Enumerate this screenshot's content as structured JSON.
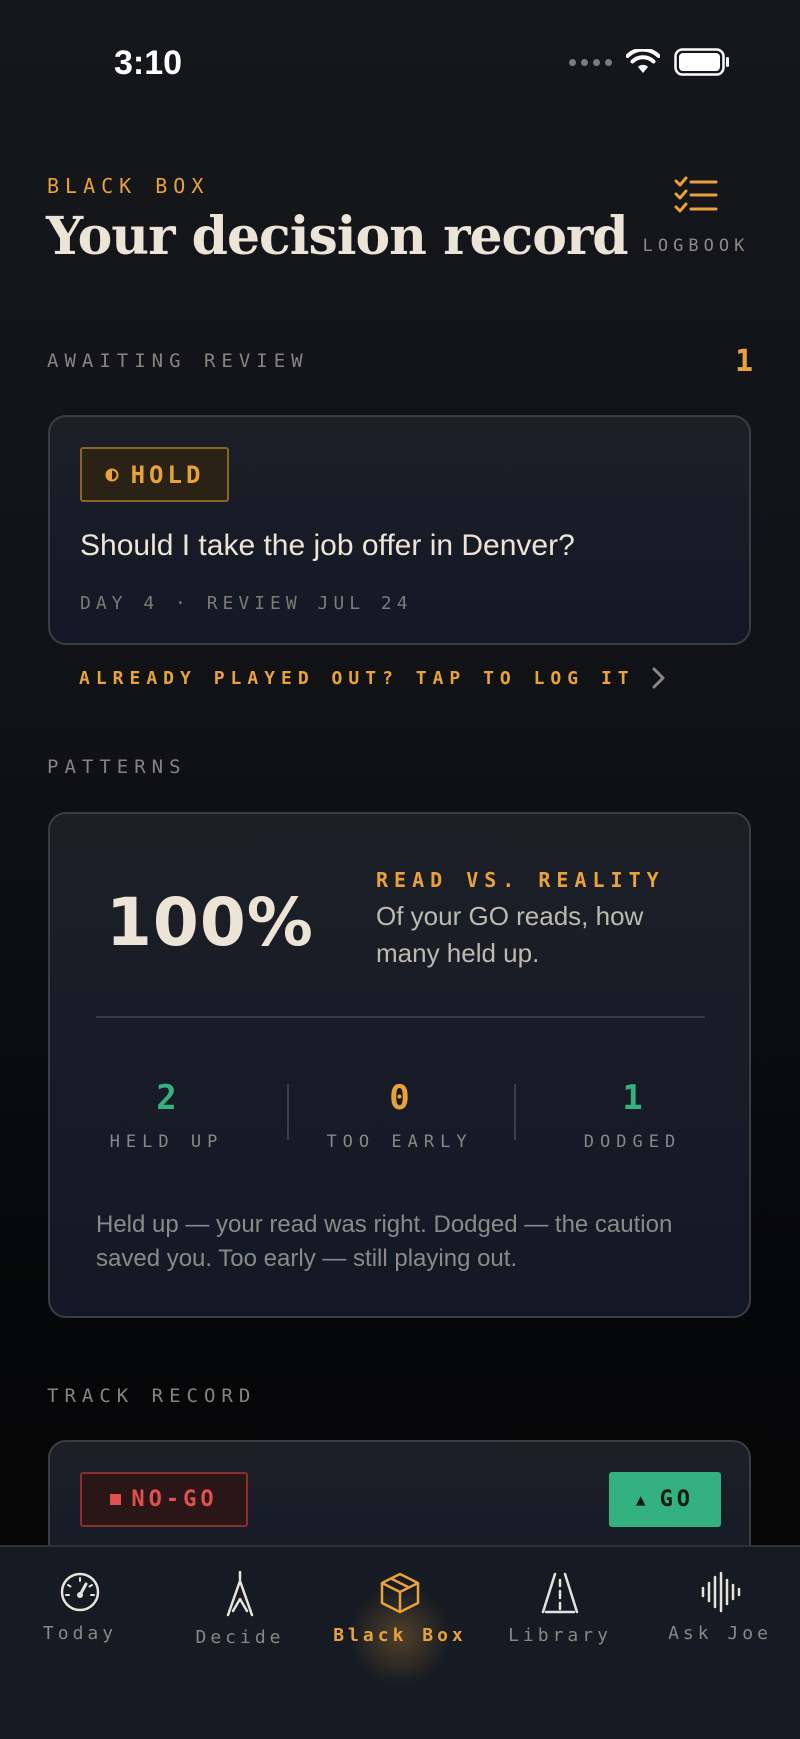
{
  "status_bar": {
    "time": "3:10"
  },
  "header": {
    "eyebrow": "BLACK BOX",
    "title": "Your decision record",
    "logbook_label": "LOGBOOK"
  },
  "awaiting": {
    "label": "AWAITING REVIEW",
    "count": "1",
    "item": {
      "badge": "HOLD",
      "badge_icon": "half-circle-icon",
      "question": "Should I take the job offer in Denver?",
      "meta": "DAY 4 · REVIEW JUL 24"
    },
    "cta": "ALREADY PLAYED OUT? TAP TO LOG IT"
  },
  "patterns": {
    "label": "PATTERNS",
    "percent": "100%",
    "rvr_label": "READ VS. REALITY",
    "rvr_desc": "Of your GO reads, how many held up.",
    "stats": [
      {
        "value": "2",
        "label": "HELD UP",
        "color": "#33b27f"
      },
      {
        "value": "0",
        "label": "TOO EARLY",
        "color": "#e9a23b"
      },
      {
        "value": "1",
        "label": "DODGED",
        "color": "#33b27f"
      }
    ],
    "legend": "Held up — your read was right. Dodged — the caution saved you. Too early — still playing out."
  },
  "track_record": {
    "label": "TRACK RECORD",
    "nogo_badge": "NO-GO",
    "go_badge": "GO"
  },
  "tabs": [
    {
      "label": "Today",
      "icon": "gauge-icon"
    },
    {
      "label": "Decide",
      "icon": "compass-icon"
    },
    {
      "label": "Black Box",
      "icon": "box-icon",
      "active": true
    },
    {
      "label": "Library",
      "icon": "road-icon"
    },
    {
      "label": "Ask Joe",
      "icon": "waveform-icon"
    }
  ],
  "colors": {
    "accent": "#e9a23b",
    "go": "#33b27f",
    "nogo": "#e0504c"
  }
}
